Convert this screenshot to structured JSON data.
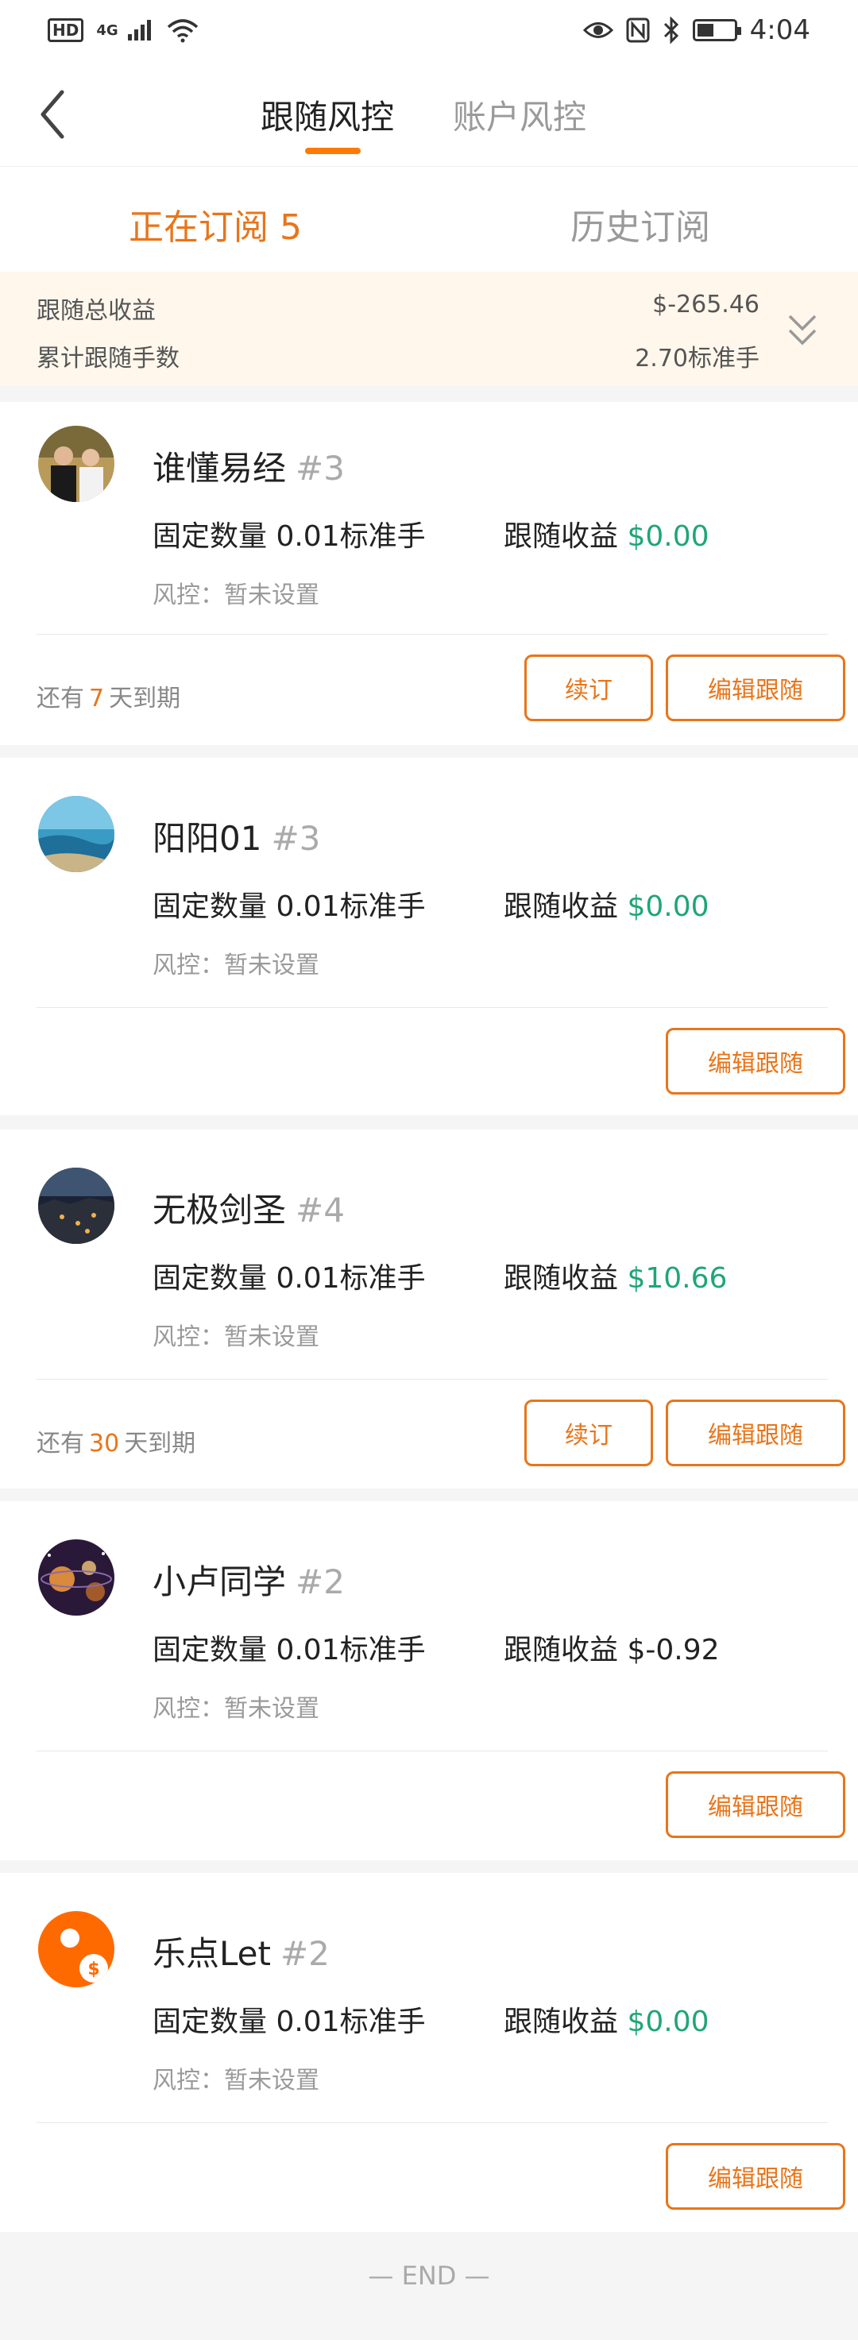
{
  "status_bar": {
    "hd": "HD",
    "network": "4G",
    "time": "4:04"
  },
  "nav": {
    "tabs": [
      {
        "label": "跟随风控",
        "active": true
      },
      {
        "label": "账户风控",
        "active": false
      }
    ]
  },
  "sub_tabs": {
    "active": "正在订阅 5",
    "history": "历史订阅"
  },
  "summary": {
    "total_profit_label": "跟随总收益",
    "total_profit_value": "$-265.46",
    "total_lots_label": "累计跟随手数",
    "total_lots_value": "2.70标准手"
  },
  "cards": [
    {
      "name": "谁懂易经",
      "rank": "#3",
      "amount": "固定数量 0.01标准手",
      "profit_label": "跟随收益",
      "profit_value": "$0.00",
      "risk": "风控：暂未设置",
      "expiry_prefix": "还有",
      "expiry_days": "7",
      "expiry_suffix": "天到期",
      "renew_label": "续订",
      "edit_label": "编辑跟随"
    },
    {
      "name": "阳阳01",
      "rank": "#3",
      "amount": "固定数量 0.01标准手",
      "profit_label": "跟随收益",
      "profit_value": "$0.00",
      "risk": "风控：暂未设置",
      "edit_label": "编辑跟随"
    },
    {
      "name": "无极剑圣",
      "rank": "#4",
      "amount": "固定数量 0.01标准手",
      "profit_label": "跟随收益",
      "profit_value": "$10.66",
      "risk": "风控：暂未设置",
      "expiry_prefix": "还有",
      "expiry_days": "30",
      "expiry_suffix": "天到期",
      "renew_label": "续订",
      "edit_label": "编辑跟随"
    },
    {
      "name": "小卢同学",
      "rank": "#2",
      "amount": "固定数量 0.01标准手",
      "profit_label": "跟随收益",
      "profit_value": "$-0.92",
      "risk": "风控：暂未设置",
      "edit_label": "编辑跟随"
    },
    {
      "name": "乐点Let",
      "rank": "#2",
      "amount": "固定数量 0.01标准手",
      "profit_label": "跟随收益",
      "profit_value": "$0.00",
      "risk": "风控：暂未设置",
      "edit_label": "编辑跟随"
    }
  ],
  "end_label": "— END —",
  "colors": {
    "accent": "#e8751a",
    "profit_green": "#1fa57a",
    "summary_bg": "#fff7ec"
  }
}
